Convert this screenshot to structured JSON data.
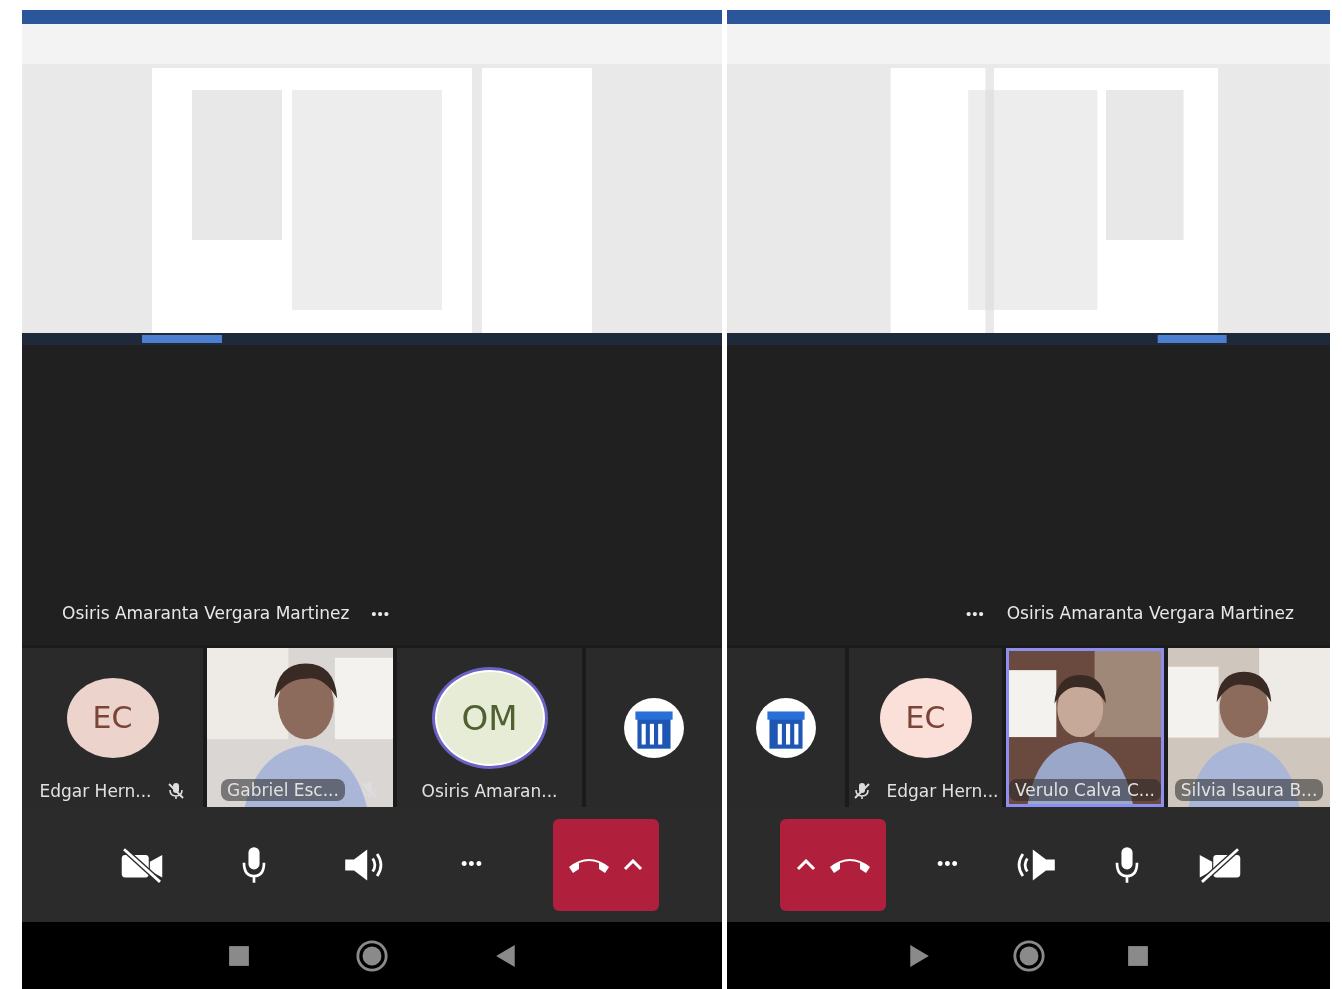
{
  "panels": [
    {
      "mirrored": false,
      "presenter": {
        "name": "Osiris Amaranta Vergara Martinez",
        "more": "•••"
      },
      "tiles": [
        {
          "kind": "avatar",
          "initials": "EC",
          "name": "Edgar Hern...",
          "muted": true,
          "speaking": false,
          "color": "#ecd3cc"
        },
        {
          "kind": "video",
          "name": "Gabriel Esc...",
          "muted": true,
          "speaking": false
        },
        {
          "kind": "avatar",
          "initials": "OM",
          "name": "Osiris Amaran...",
          "muted": false,
          "speaking": true,
          "color": "#e6ecd5"
        },
        {
          "kind": "logo"
        }
      ],
      "controls": [
        {
          "kind": "camera"
        },
        {
          "kind": "mic"
        },
        {
          "kind": "speaker"
        },
        {
          "kind": "more",
          "label": "•••"
        },
        {
          "kind": "hangup"
        }
      ]
    },
    {
      "mirrored": true,
      "presenter": {
        "name": "Osiris Amaranta Vergara Martinez",
        "more": "•••"
      },
      "tiles": [
        {
          "kind": "logo"
        },
        {
          "kind": "avatar",
          "initials": "EC",
          "name": "Edgar Hern...",
          "muted": true,
          "speaking": false,
          "color": "#fbe0d9"
        },
        {
          "kind": "video",
          "name": "Verulo Calva C...",
          "muted": false,
          "speaking": true
        },
        {
          "kind": "video",
          "name": "Silvia Isaura B...",
          "muted": false,
          "speaking": false
        }
      ],
      "controls": [
        {
          "kind": "hangup"
        },
        {
          "kind": "more",
          "label": "•••"
        },
        {
          "kind": "speaker"
        },
        {
          "kind": "mic"
        },
        {
          "kind": "camera"
        }
      ]
    }
  ]
}
